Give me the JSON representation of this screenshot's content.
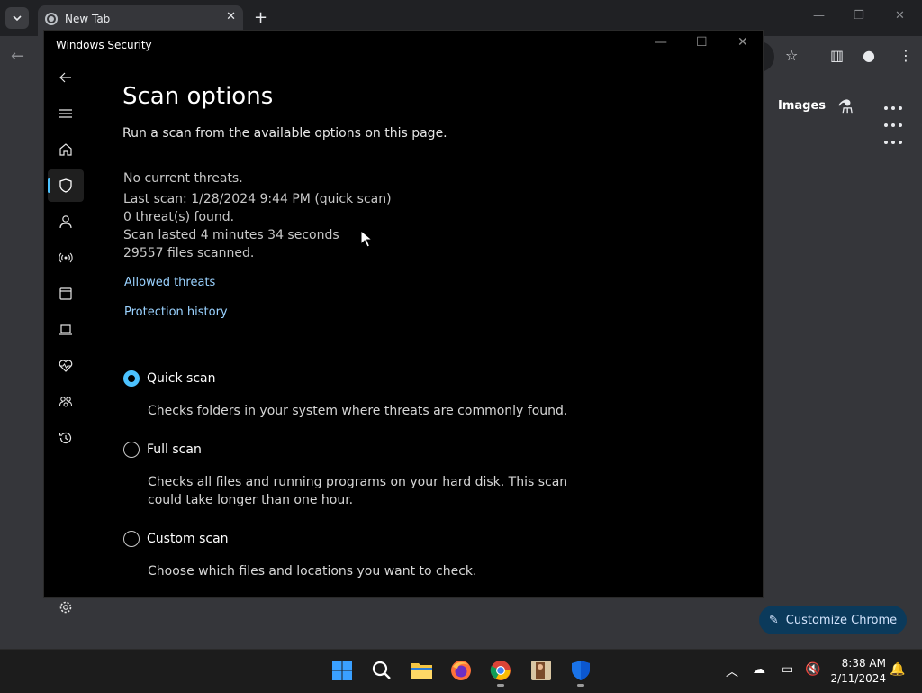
{
  "browser": {
    "tab_title": "New Tab",
    "images_link": "Images",
    "customize_label": "Customize Chrome"
  },
  "window": {
    "title": "Windows Security"
  },
  "nav": {
    "items": [
      "back-icon",
      "menu-icon",
      "home-icon",
      "shield-icon",
      "account-icon",
      "network-icon",
      "app-browser-icon",
      "device-icon",
      "health-icon",
      "family-icon",
      "history-icon",
      "settings-icon"
    ],
    "active": "shield-icon"
  },
  "content": {
    "title": "Scan options",
    "subtitle": "Run a scan from the available options on this page.",
    "status": "No current threats.",
    "last_scan": "Last scan: 1/28/2024 9:44 PM (quick scan)",
    "threats_found": "0 threat(s) found.",
    "scan_duration": "Scan lasted 4 minutes 34 seconds",
    "files_scanned": "29557 files scanned.",
    "allowed_threats": "Allowed threats",
    "protection_history": "Protection history"
  },
  "scan_options": [
    {
      "label": "Quick scan",
      "description": "Checks folders in your system where threats are commonly found.",
      "selected": true
    },
    {
      "label": "Full scan",
      "description": "Checks all files and running programs on your hard disk. This scan could take longer than one hour.",
      "selected": false
    },
    {
      "label": "Custom scan",
      "description": "Choose which files and locations you want to check.",
      "selected": false
    }
  ],
  "taskbar": {
    "apps": [
      "windows-start-icon",
      "search-icon",
      "file-explorer-icon",
      "firefox-icon",
      "chrome-icon",
      "game-app-icon",
      "windows-security-icon"
    ],
    "time": "8:38 AM",
    "date": "2/11/2024"
  },
  "colors": {
    "accent": "#4cc2ff",
    "link": "#9ad2ff",
    "window_bg": "#000000"
  }
}
